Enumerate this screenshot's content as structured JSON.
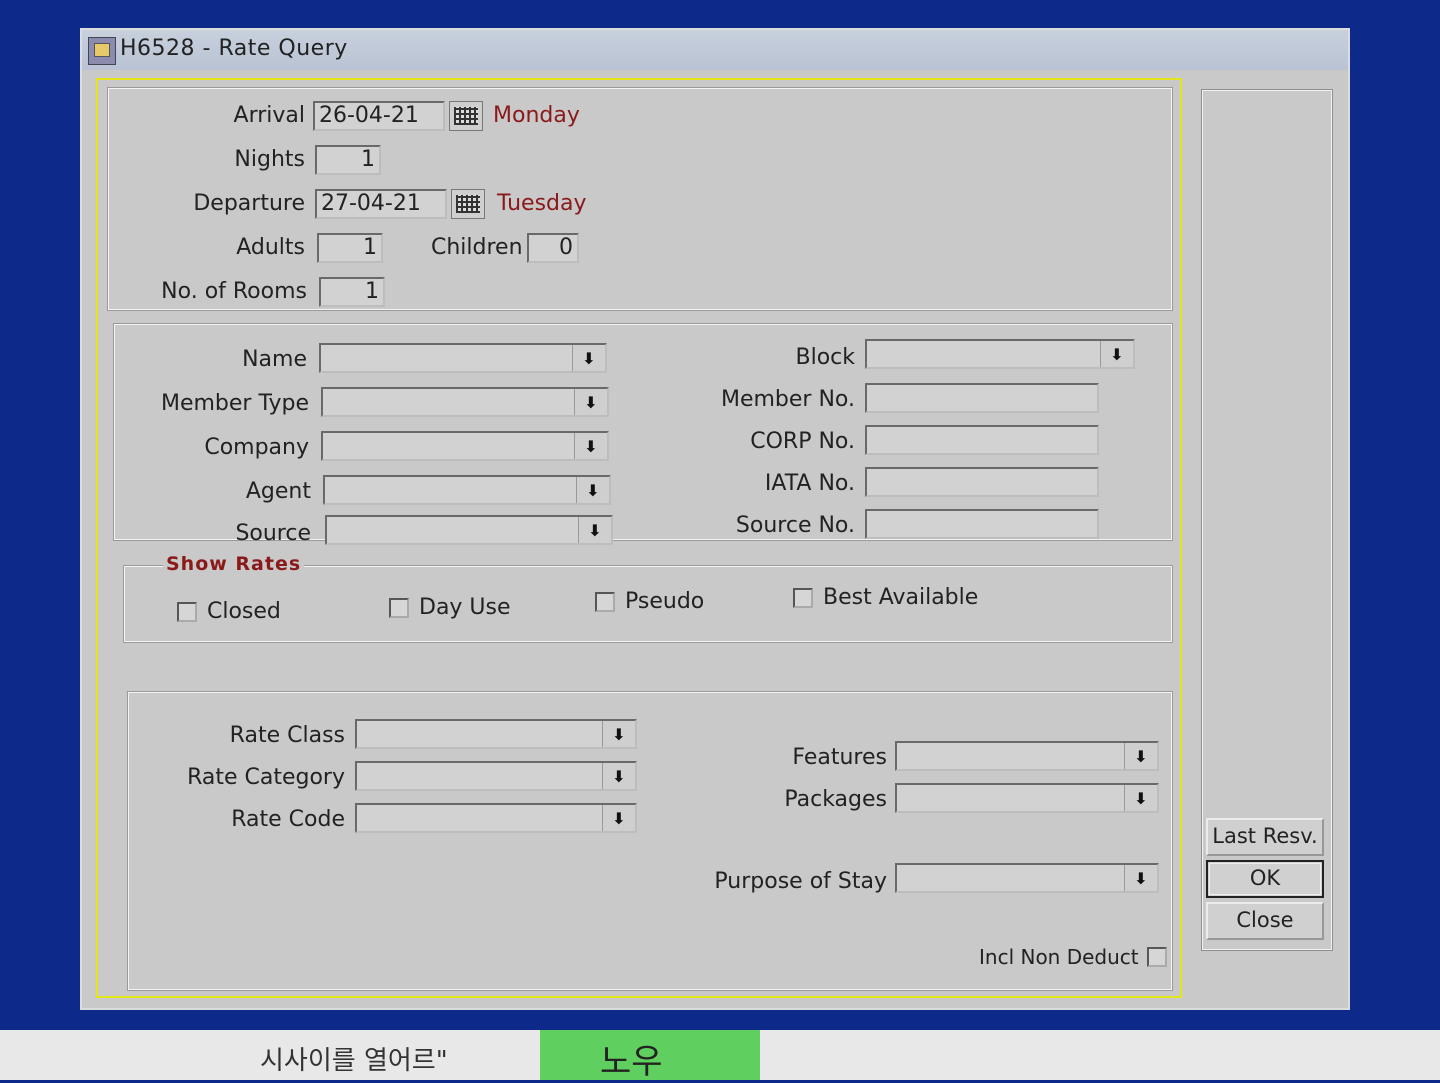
{
  "window": {
    "title": "H6528 - Rate Query"
  },
  "dates": {
    "arrival_label": "Arrival",
    "arrival_value": "26-04-21",
    "arrival_day": "Monday",
    "nights_label": "Nights",
    "nights_value": "1",
    "departure_label": "Departure",
    "departure_value": "27-04-21",
    "departure_day": "Tuesday",
    "adults_label": "Adults",
    "adults_value": "1",
    "children_label": "Children",
    "children_value": "0",
    "rooms_label": "No. of Rooms",
    "rooms_value": "1"
  },
  "profile": {
    "name_label": "Name",
    "member_type_label": "Member Type",
    "company_label": "Company",
    "agent_label": "Agent",
    "source_label": "Source",
    "block_label": "Block",
    "member_no_label": "Member No.",
    "corp_no_label": "CORP No.",
    "iata_no_label": "IATA No.",
    "source_no_label": "Source No."
  },
  "show_rates": {
    "legend": "Show Rates",
    "closed": "Closed",
    "day_use": "Day Use",
    "pseudo": "Pseudo",
    "best_available": "Best Available"
  },
  "rates": {
    "rate_class_label": "Rate Class",
    "rate_category_label": "Rate Category",
    "rate_code_label": "Rate Code",
    "features_label": "Features",
    "packages_label": "Packages",
    "purpose_label": "Purpose of Stay",
    "incl_non_deduct_label": "Incl Non Deduct"
  },
  "buttons": {
    "last_resv": "Last Resv.",
    "ok": "OK",
    "close": "Close"
  },
  "background": {
    "korean_text": "시사이를 열어르\"",
    "green_tab_text": "노우"
  },
  "icons": {
    "calendar": "calendar-icon",
    "dropdown": "down-arrow-icon",
    "app": "app-icon"
  }
}
